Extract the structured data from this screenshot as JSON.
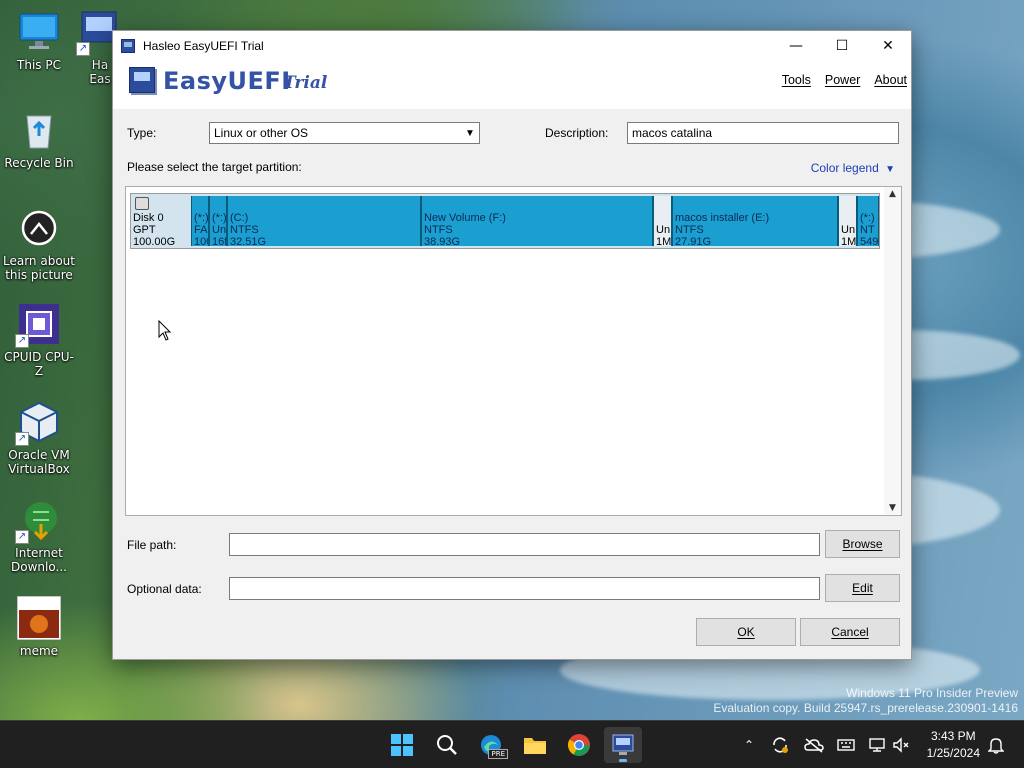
{
  "desktop": {
    "icons": [
      {
        "label": "This PC"
      },
      {
        "label": "Ha\nEas"
      },
      {
        "label": "Recycle Bin"
      },
      {
        "label": "Learn about\nthis picture"
      },
      {
        "label": "CPUID CPU-Z"
      },
      {
        "label": "Oracle VM\nVirtualBox"
      },
      {
        "label": "Internet\nDownlo..."
      },
      {
        "label": "meme"
      }
    ],
    "watermark": {
      "line1": "Windows 11 Pro Insider Preview",
      "line2": "Evaluation copy. Build 25947.rs_prerelease.230901-1416"
    }
  },
  "window": {
    "title": "Hasleo EasyUEFI Trial",
    "brand": "EasyUEFI",
    "brand_edition": "Trial",
    "menu": {
      "tools": "Tools",
      "power": "Power",
      "about": "About"
    },
    "type_label": "Type:",
    "type_value": "Linux or other OS",
    "description_label": "Description:",
    "description_value": "macos catalina",
    "select_partition_label": "Please select the target partition:",
    "color_legend": "Color legend",
    "disk": {
      "name": "Disk 0",
      "style": "GPT",
      "size": "100.00G"
    },
    "partitions": [
      {
        "l1": "(*:)",
        "l2": "FA",
        "l3": "100"
      },
      {
        "l1": "(*:)",
        "l2": "Un",
        "l3": "16f"
      },
      {
        "l1": "(C:)",
        "l2": "NTFS",
        "l3": "32.51G"
      },
      {
        "l1": "New Volume (F:)",
        "l2": "NTFS",
        "l3": "38.93G"
      },
      {
        "l1": "",
        "l2": "Un",
        "l3": "1M"
      },
      {
        "l1": "macos installer (E:)",
        "l2": "NTFS",
        "l3": "27.91G"
      },
      {
        "l1": "",
        "l2": "Un",
        "l3": "1M"
      },
      {
        "l1": "(*:)",
        "l2": "NT",
        "l3": "549"
      }
    ],
    "file_path_label": "File path:",
    "file_path_value": "",
    "browse": "Browse",
    "optional_data_label": "Optional data:",
    "optional_data_value": "",
    "edit": "Edit",
    "ok": "OK",
    "cancel": "Cancel"
  },
  "taskbar": {
    "time": "3:43 PM",
    "date": "1/25/2024",
    "edge_badge": "PRE"
  },
  "colors": {
    "partition_fill": "#1a9fd0",
    "brand_blue": "#3553a6",
    "legend_link": "#1a3fb8",
    "taskbar": "#202020"
  }
}
